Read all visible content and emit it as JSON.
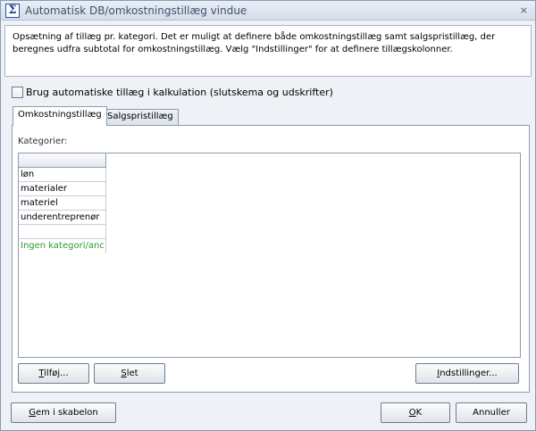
{
  "window": {
    "title": "Automatisk DB/omkostningstillæg vindue",
    "close_glyph": "×"
  },
  "info": {
    "line1": "Opsætning af tillæg pr. kategori. Det er muligt at definere både omkostningstillæg samt salgspristillæg, der",
    "line2": "beregnes udfra subtotal for omkostningstillæg. Vælg \"Indstillinger\" for at definere tillægskolonner."
  },
  "auto_checkbox": {
    "label": "Brug automatiske tillæg i kalkulation (slutskema og udskrifter)",
    "checked": false
  },
  "tabs": [
    {
      "label": "Omkostningstillæg",
      "active": true
    },
    {
      "label": "Salgspristillæg",
      "active": false
    }
  ],
  "categories": {
    "label": "Kategorier:",
    "items": [
      "løn",
      "materialer",
      "materiel",
      "underentreprenør",
      "",
      "Ingen kategori/anc"
    ]
  },
  "buttons": {
    "add": {
      "mnemonic": "T",
      "rest": "ilføj..."
    },
    "delete": {
      "mnemonic": "S",
      "rest": "let"
    },
    "settings": {
      "mnemonic": "I",
      "rest": "ndstillinger..."
    },
    "save_template": {
      "mnemonic": "G",
      "rest": "em i skabelon"
    },
    "ok": {
      "mnemonic": "O",
      "rest": "K"
    },
    "cancel": {
      "label": "Annuller"
    }
  },
  "colors": {
    "no_category_text": "#2e9a2e"
  }
}
